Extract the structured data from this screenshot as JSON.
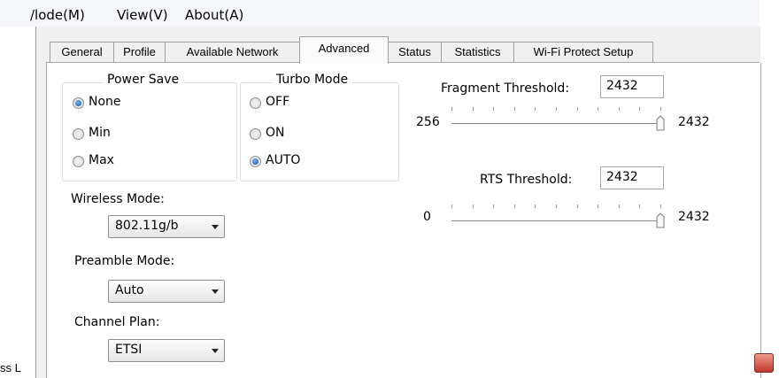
{
  "menu": {
    "items": [
      "/lode(M)",
      "View(V)",
      "About(A)"
    ]
  },
  "tabs": [
    "General",
    "Profile",
    "Available Network",
    "Advanced",
    "Status",
    "Statistics",
    "Wi-Fi Protect Setup"
  ],
  "active_tab": "Advanced",
  "power_save": {
    "title": "Power Save",
    "options": [
      "None",
      "Min",
      "Max"
    ],
    "selected": "None"
  },
  "turbo_mode": {
    "title": "Turbo Mode",
    "options": [
      "OFF",
      "ON",
      "AUTO"
    ],
    "selected": "AUTO"
  },
  "wireless_mode": {
    "label": "Wireless Mode:",
    "value": "802.11g/b"
  },
  "preamble_mode": {
    "label": "Preamble Mode:",
    "value": "Auto"
  },
  "channel_plan": {
    "label": "Channel Plan:",
    "value": "ETSI"
  },
  "fragment": {
    "label": "Fragment Threshold:",
    "value": "2432",
    "min": "256",
    "max": "2432",
    "slider_fraction": 1.0
  },
  "rts": {
    "label": "RTS Threshold:",
    "value": "2432",
    "min": "0",
    "max": "2432",
    "slider_fraction": 1.0
  },
  "side": {
    "left_text": "ss L"
  },
  "colors": {
    "accent": "#1f5fb8",
    "close_button": "#c0392b"
  }
}
